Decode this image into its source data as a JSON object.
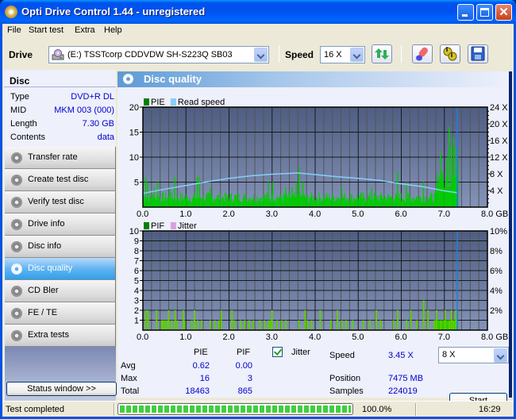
{
  "window": {
    "title": "Opti Drive Control 1.44 - unregistered",
    "controls": [
      "minimize",
      "maximize",
      "close"
    ],
    "close_glyph": "✕"
  },
  "menu": [
    "File",
    "Start test",
    "Extra",
    "Help"
  ],
  "toolbar": {
    "drive_label": "Drive",
    "drive_value": "(E:)  TSSTcorp CDDVDW SH-S223Q SB03",
    "speed_label": "Speed",
    "speed_value": "16 X",
    "buttons": [
      "refresh-icon",
      "eraser-icon",
      "settings-icon",
      "save-icon"
    ]
  },
  "disc": {
    "header": "Disc",
    "rows": [
      {
        "key": "Type",
        "value": "DVD+R DL"
      },
      {
        "key": "MID",
        "value": "MKM 003 (000)"
      },
      {
        "key": "Length",
        "value": "7.30 GB"
      },
      {
        "key": "Contents",
        "value": "data"
      }
    ]
  },
  "nav": [
    {
      "label": "Transfer rate",
      "active": false
    },
    {
      "label": "Create test disc",
      "active": false
    },
    {
      "label": "Verify test disc",
      "active": false
    },
    {
      "label": "Drive info",
      "active": false
    },
    {
      "label": "Disc info",
      "active": false
    },
    {
      "label": "Disc quality",
      "active": true
    },
    {
      "label": "CD Bler",
      "active": false
    },
    {
      "label": "FE / TE",
      "active": false
    },
    {
      "label": "Extra tests",
      "active": false
    }
  ],
  "status_window_button": "Status window >>",
  "panel": {
    "title": "Disc quality"
  },
  "chart_data": [
    {
      "type": "bar",
      "title": "",
      "legend": [
        {
          "name": "PIE",
          "color": "#008000"
        },
        {
          "name": "Read speed",
          "color": "#87cefa"
        }
      ],
      "legend_position": "top-left",
      "xlabel": "GB",
      "x_ticks": [
        "0.0",
        "1.0",
        "2.0",
        "3.0",
        "4.0",
        "5.0",
        "6.0",
        "7.0",
        "8.0 GB"
      ],
      "xlim": [
        0,
        8
      ],
      "y_left_ticks": [
        "5",
        "10",
        "15",
        "20"
      ],
      "ylim_left": [
        0,
        20
      ],
      "y_right_ticks": [
        "4 X",
        "8 X",
        "12 X",
        "16 X",
        "20 X",
        "24 X"
      ],
      "ylim_right": [
        0,
        24
      ],
      "grid": true,
      "end_marker_gb": 7.3,
      "series": [
        {
          "name": "PIE",
          "x_range": [
            0,
            7.3
          ],
          "baseline": 2,
          "typical_range": [
            1,
            3
          ],
          "peaks": [
            {
              "x": 0.05,
              "y": 6
            },
            {
              "x": 0.1,
              "y": 5
            },
            {
              "x": 0.25,
              "y": 4
            },
            {
              "x": 0.33,
              "y": 5
            },
            {
              "x": 0.72,
              "y": 6
            },
            {
              "x": 0.62,
              "y": 4
            },
            {
              "x": 1.25,
              "y": 6
            },
            {
              "x": 1.3,
              "y": 6
            },
            {
              "x": 1.55,
              "y": 4
            },
            {
              "x": 2.9,
              "y": 5
            },
            {
              "x": 3.0,
              "y": 5
            },
            {
              "x": 3.3,
              "y": 4
            },
            {
              "x": 3.45,
              "y": 4
            },
            {
              "x": 3.55,
              "y": 5
            },
            {
              "x": 3.62,
              "y": 8
            },
            {
              "x": 3.7,
              "y": 5
            },
            {
              "x": 4.6,
              "y": 4
            },
            {
              "x": 5.3,
              "y": 4
            },
            {
              "x": 5.9,
              "y": 7
            },
            {
              "x": 6.1,
              "y": 5
            },
            {
              "x": 6.5,
              "y": 5
            },
            {
              "x": 6.8,
              "y": 4
            },
            {
              "x": 6.9,
              "y": 11
            },
            {
              "x": 6.95,
              "y": 7
            },
            {
              "x": 7.05,
              "y": 10
            },
            {
              "x": 7.1,
              "y": 16
            },
            {
              "x": 7.15,
              "y": 12
            },
            {
              "x": 7.2,
              "y": 14
            },
            {
              "x": 7.25,
              "y": 12
            },
            {
              "x": 7.3,
              "y": 9
            }
          ]
        },
        {
          "name": "Read speed",
          "unit": "X",
          "points": [
            {
              "x": 0.0,
              "y": 3.3
            },
            {
              "x": 0.5,
              "y": 4.3
            },
            {
              "x": 1.0,
              "y": 5.2
            },
            {
              "x": 1.5,
              "y": 6.1
            },
            {
              "x": 2.0,
              "y": 6.9
            },
            {
              "x": 2.5,
              "y": 7.5
            },
            {
              "x": 3.0,
              "y": 7.9
            },
            {
              "x": 3.6,
              "y": 8.2
            },
            {
              "x": 4.0,
              "y": 7.8
            },
            {
              "x": 4.5,
              "y": 7.3
            },
            {
              "x": 5.0,
              "y": 6.9
            },
            {
              "x": 5.5,
              "y": 6.4
            },
            {
              "x": 6.0,
              "y": 5.6
            },
            {
              "x": 6.5,
              "y": 4.9
            },
            {
              "x": 7.0,
              "y": 3.9
            },
            {
              "x": 7.3,
              "y": 3.45
            }
          ]
        }
      ]
    },
    {
      "type": "bar",
      "title": "",
      "legend": [
        {
          "name": "PIF",
          "color": "#008000"
        },
        {
          "name": "Jitter",
          "color": "#dda0dd"
        }
      ],
      "legend_position": "top-left",
      "xlabel": "GB",
      "x_ticks": [
        "0.0",
        "1.0",
        "2.0",
        "3.0",
        "4.0",
        "5.0",
        "6.0",
        "7.0",
        "8.0 GB"
      ],
      "xlim": [
        0,
        8
      ],
      "y_left_ticks": [
        "1",
        "2",
        "3",
        "4",
        "5",
        "6",
        "7",
        "8",
        "9",
        "10"
      ],
      "ylim_left": [
        0,
        10
      ],
      "y_right_ticks": [
        "2%",
        "4%",
        "6%",
        "8%",
        "10%"
      ],
      "ylim_right": [
        0,
        10
      ],
      "grid": true,
      "end_marker_gb": 7.3,
      "series": [
        {
          "name": "PIF",
          "values_gb": [
            {
              "x": 0.05,
              "y": 2
            },
            {
              "x": 0.1,
              "y": 2
            },
            {
              "x": 0.3,
              "y": 2
            },
            {
              "x": 0.42,
              "y": 1
            },
            {
              "x": 0.45,
              "y": 1
            },
            {
              "x": 0.5,
              "y": 1
            },
            {
              "x": 0.55,
              "y": 1
            },
            {
              "x": 0.58,
              "y": 2
            },
            {
              "x": 0.65,
              "y": 1
            },
            {
              "x": 0.73,
              "y": 2
            },
            {
              "x": 0.78,
              "y": 1
            },
            {
              "x": 0.92,
              "y": 2
            },
            {
              "x": 0.95,
              "y": 1
            },
            {
              "x": 1.12,
              "y": 1
            },
            {
              "x": 1.18,
              "y": 2
            },
            {
              "x": 1.25,
              "y": 1
            },
            {
              "x": 1.35,
              "y": 1
            },
            {
              "x": 1.55,
              "y": 1
            },
            {
              "x": 1.65,
              "y": 1
            },
            {
              "x": 1.75,
              "y": 1
            },
            {
              "x": 1.8,
              "y": 2
            },
            {
              "x": 2.05,
              "y": 2
            },
            {
              "x": 2.1,
              "y": 1
            },
            {
              "x": 2.25,
              "y": 1
            },
            {
              "x": 2.35,
              "y": 1
            },
            {
              "x": 2.45,
              "y": 1
            },
            {
              "x": 2.55,
              "y": 1
            },
            {
              "x": 2.7,
              "y": 1
            },
            {
              "x": 2.8,
              "y": 1
            },
            {
              "x": 2.9,
              "y": 1
            },
            {
              "x": 2.95,
              "y": 1
            },
            {
              "x": 2.98,
              "y": 2
            },
            {
              "x": 3.1,
              "y": 1
            },
            {
              "x": 3.2,
              "y": 1
            },
            {
              "x": 3.3,
              "y": 1
            },
            {
              "x": 3.6,
              "y": 1
            },
            {
              "x": 3.75,
              "y": 2
            },
            {
              "x": 3.8,
              "y": 1
            },
            {
              "x": 3.9,
              "y": 1
            },
            {
              "x": 4.1,
              "y": 2
            },
            {
              "x": 4.35,
              "y": 1
            },
            {
              "x": 4.5,
              "y": 2
            },
            {
              "x": 4.6,
              "y": 1
            },
            {
              "x": 4.7,
              "y": 1
            },
            {
              "x": 4.85,
              "y": 1
            },
            {
              "x": 5.1,
              "y": 1
            },
            {
              "x": 5.25,
              "y": 1
            },
            {
              "x": 5.4,
              "y": 2
            },
            {
              "x": 5.5,
              "y": 1
            },
            {
              "x": 5.8,
              "y": 1
            },
            {
              "x": 5.9,
              "y": 2
            },
            {
              "x": 6.1,
              "y": 1
            },
            {
              "x": 6.2,
              "y": 2
            },
            {
              "x": 6.35,
              "y": 1
            },
            {
              "x": 6.5,
              "y": 3
            },
            {
              "x": 6.6,
              "y": 2
            },
            {
              "x": 6.75,
              "y": 1
            },
            {
              "x": 6.8,
              "y": 2
            },
            {
              "x": 6.9,
              "y": 1
            },
            {
              "x": 7.0,
              "y": 2
            },
            {
              "x": 7.1,
              "y": 1
            },
            {
              "x": 7.15,
              "y": 2
            },
            {
              "x": 7.2,
              "y": 1
            },
            {
              "x": 7.25,
              "y": 2
            }
          ],
          "dense_region_gb": [
            6.75,
            7.3
          ]
        }
      ]
    }
  ],
  "stats": {
    "col_headers": [
      "PIE",
      "PIF"
    ],
    "jitter_label": "Jitter",
    "jitter_checked": true,
    "rows": [
      {
        "label": "Avg",
        "pie": "0.62",
        "pif": "0.00"
      },
      {
        "label": "Max",
        "pie": "16",
        "pif": "3"
      },
      {
        "label": "Total",
        "pie": "18463",
        "pif": "865"
      }
    ],
    "speed_label": "Speed",
    "speed_value": "3.45 X",
    "speed_select": "8 X",
    "position_label": "Position",
    "position_value": "7475 MB",
    "samples_label": "Samples",
    "samples_value": "224019",
    "start_button": "Start"
  },
  "statusbar": {
    "text": "Test completed",
    "progress_percent": 100.0,
    "progress_label": "100.0%",
    "time": "16:29"
  }
}
